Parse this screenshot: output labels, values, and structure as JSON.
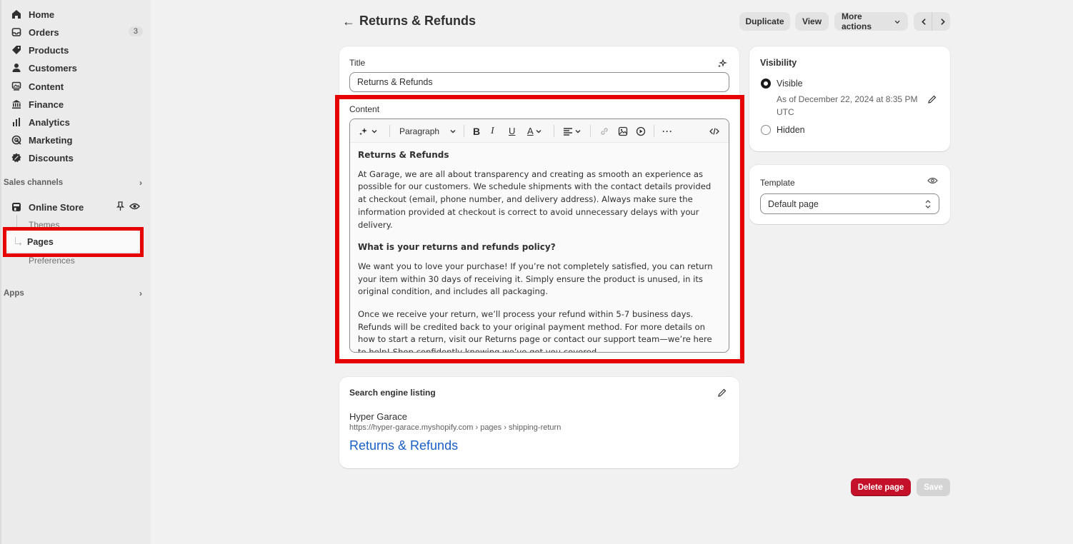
{
  "sidebar": {
    "items": [
      {
        "label": "Home",
        "icon": "home-icon"
      },
      {
        "label": "Orders",
        "icon": "inbox-icon",
        "badge": "3"
      },
      {
        "label": "Products",
        "icon": "tag-icon"
      },
      {
        "label": "Customers",
        "icon": "person-icon"
      },
      {
        "label": "Content",
        "icon": "image-icon"
      },
      {
        "label": "Finance",
        "icon": "bank-icon"
      },
      {
        "label": "Analytics",
        "icon": "bar-chart-icon"
      },
      {
        "label": "Marketing",
        "icon": "target-icon"
      },
      {
        "label": "Discounts",
        "icon": "discount-icon"
      }
    ],
    "sales_channels_label": "Sales channels",
    "online_store_label": "Online Store",
    "sub_items": {
      "themes": "Themes",
      "pages": "Pages",
      "preferences": "Preferences"
    },
    "apps_label": "Apps"
  },
  "header": {
    "title": "Returns & Refunds",
    "duplicate_label": "Duplicate",
    "view_label": "View",
    "more_actions_label": "More actions"
  },
  "title_card": {
    "title_label": "Title",
    "title_value": "Returns & Refunds",
    "content_label": "Content",
    "paragraph_label": "Paragraph",
    "heading": "Returns & Refunds",
    "para1": "At Garage, we are all about transparency and creating as smooth an experience as possible for our customers. We schedule shipments with the contact details provided at checkout (email, phone number, and delivery address). Always make sure the information provided at checkout is correct to avoid unnecessary delays with your delivery.",
    "subheading": "What is your returns and refunds policy?",
    "para2": "We want you to love your purchase! If you’re not completely satisfied, you can return your item within 30 days of receiving it. Simply ensure the product is unused, in its original condition, and includes all packaging.",
    "para3": "Once we receive your return, we’ll process your refund within 5-7 business days. Refunds will be credited back to your original payment method. For more details on how to start a return, visit our Returns page or contact our support team—we’re here to help! Shop confidently knowing we’ve got you covered."
  },
  "seo": {
    "label": "Search engine listing",
    "site_name": "Hyper Garace",
    "url": "https://hyper-garace.myshopify.com › pages › shipping-return",
    "title": "Returns & Refunds"
  },
  "visibility": {
    "label": "Visibility",
    "visible_label": "Visible",
    "date_text": "As of December 22, 2024 at 8:35 PM UTC",
    "hidden_label": "Hidden",
    "selected": "Visible"
  },
  "template": {
    "label": "Template",
    "value": "Default page"
  },
  "footer": {
    "delete_label": "Delete page",
    "save_label": "Save"
  },
  "colors": {
    "highlight": "#e60000",
    "delete": "#c5102a",
    "link": "#1a5fc7"
  }
}
